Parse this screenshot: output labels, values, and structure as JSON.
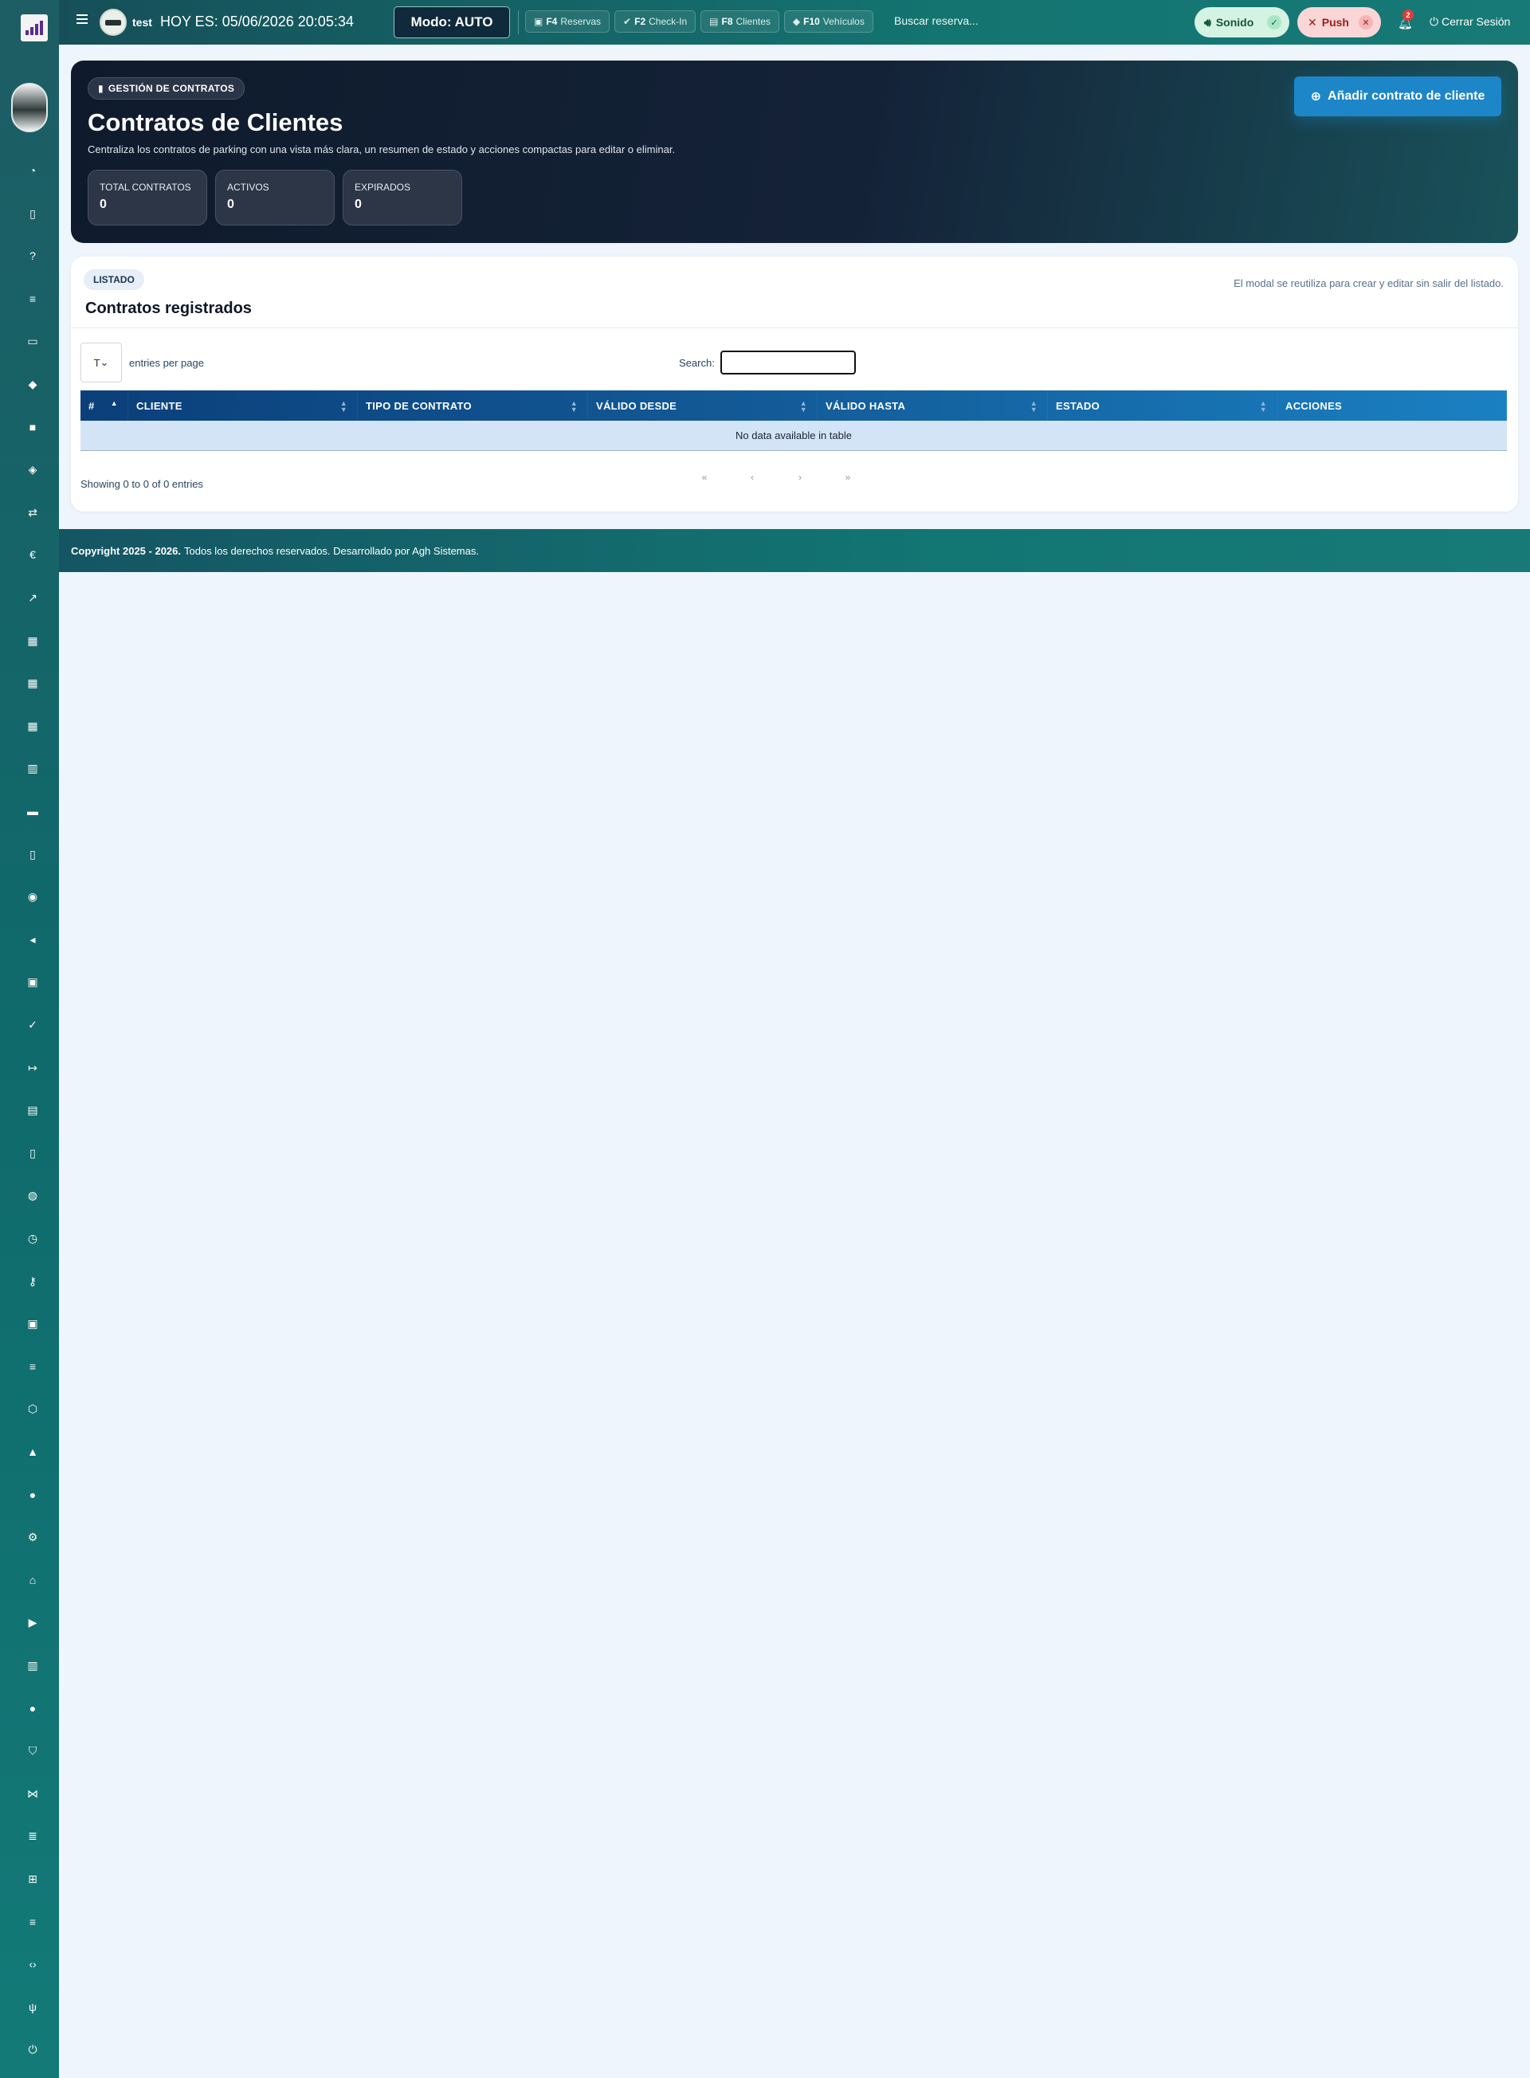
{
  "topbar": {
    "user": "test",
    "date_text": "HOY ES: 05/06/2026 20:05:34",
    "mode_label": "Modo: AUTO",
    "shortcuts": [
      {
        "key": "F4",
        "label": "Reservas"
      },
      {
        "key": "F2",
        "label": "Check-In"
      },
      {
        "key": "F8",
        "label": "Clientes"
      },
      {
        "key": "F10",
        "label": "Vehículos"
      }
    ],
    "search_placeholder": "Buscar reserva...",
    "sound_label": "Sonido",
    "push_label": "Push",
    "notifications_count": "2",
    "logout_label": "Cerrar Sesión"
  },
  "hero": {
    "tag": "GESTIÓN DE CONTRATOS",
    "title": "Contratos de Clientes",
    "description": "Centraliza los contratos de parking con una vista más clara, un resumen de estado y acciones compactas para editar o eliminar.",
    "add_button": "Añadir contrato de cliente",
    "stats": [
      {
        "label": "TOTAL CONTRATOS",
        "value": "0"
      },
      {
        "label": "ACTIVOS",
        "value": "0"
      },
      {
        "label": "EXPIRADOS",
        "value": "0"
      }
    ]
  },
  "listing": {
    "tag": "LISTADO",
    "note": "El modal se reutiliza para crear y editar sin salir del listado.",
    "title": "Contratos registrados",
    "per_page_value": "T",
    "per_page_text": "entries per page",
    "search_label": "Search:",
    "columns": [
      "#",
      "CLIENTE",
      "TIPO DE CONTRATO",
      "VÁLIDO DESDE",
      "VÁLIDO HASTA",
      "ESTADO",
      "ACCIONES"
    ],
    "empty_text": "No data available in table",
    "showing_text": "Showing 0 to 0 of 0 entries",
    "pager": [
      "«",
      "‹",
      "›",
      "»"
    ]
  },
  "footer": {
    "copyright_bold": "Copyright 2025 - 2026.",
    "copyright_text": "Todos los derechos reservados. Desarrollado por Agh Sistemas."
  },
  "sidebar": {
    "icons": [
      "dashboard-icon",
      "file-icon",
      "help-icon",
      "list-icon",
      "id-card-icon",
      "car-icon",
      "truck-icon",
      "layers-icon",
      "transfer-icon",
      "euro-icon",
      "chart-icon",
      "calendar-icon",
      "calendar-check-icon",
      "calendar-x-icon",
      "receipt-icon",
      "card-icon",
      "document-icon",
      "camera-icon",
      "speaker-icon",
      "parking-icon",
      "check-icon",
      "sign-out-icon",
      "printer-icon",
      "file-text-icon",
      "users-icon",
      "clock-icon",
      "keys-icon",
      "briefcase-icon",
      "list-ul-icon",
      "cube-icon",
      "bell-icon",
      "user-icon",
      "settings-icon",
      "garage-icon",
      "video-icon",
      "book-icon",
      "user-lock-icon",
      "shield-icon",
      "network-icon",
      "server-icon",
      "sitemap-icon",
      "list-ol-icon",
      "code-icon",
      "antenna-icon",
      "power-icon"
    ]
  },
  "colors": {
    "sidebar": "#0f6a6b",
    "accent_button": "#1d86c9",
    "table_header": "#135c99",
    "hero_bg": "#142238"
  }
}
